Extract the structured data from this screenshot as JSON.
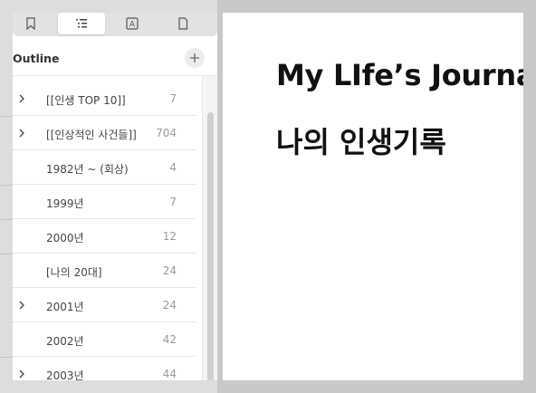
{
  "sidebar": {
    "tabs": [
      {
        "icon": "bookmark-icon"
      },
      {
        "icon": "outline-list-icon",
        "active": true
      },
      {
        "icon": "text-box-icon",
        "glyph": "A"
      },
      {
        "icon": "page-icon"
      }
    ],
    "header": {
      "title": "Outline",
      "add_icon": "plus-icon"
    },
    "items": [
      {
        "label": "[[인생 TOP 10]]",
        "count": "7",
        "expandable": true
      },
      {
        "label": "[[인상적인 사건들]]",
        "count": "704",
        "expandable": true
      },
      {
        "label": "1982년 ~ (회상)",
        "count": "4",
        "expandable": false
      },
      {
        "label": "1999년",
        "count": "7",
        "expandable": false
      },
      {
        "label": "2000년",
        "count": "12",
        "expandable": false
      },
      {
        "label": "[나의 20대]",
        "count": "24",
        "expandable": false
      },
      {
        "label": "2001년",
        "count": "24",
        "expandable": true
      },
      {
        "label": "2002년",
        "count": "42",
        "expandable": false
      },
      {
        "label": "2003년",
        "count": "44",
        "expandable": true
      }
    ]
  },
  "document": {
    "title_line1": "My LIfe’s Journal",
    "title_line2": "나의 인생기록"
  }
}
